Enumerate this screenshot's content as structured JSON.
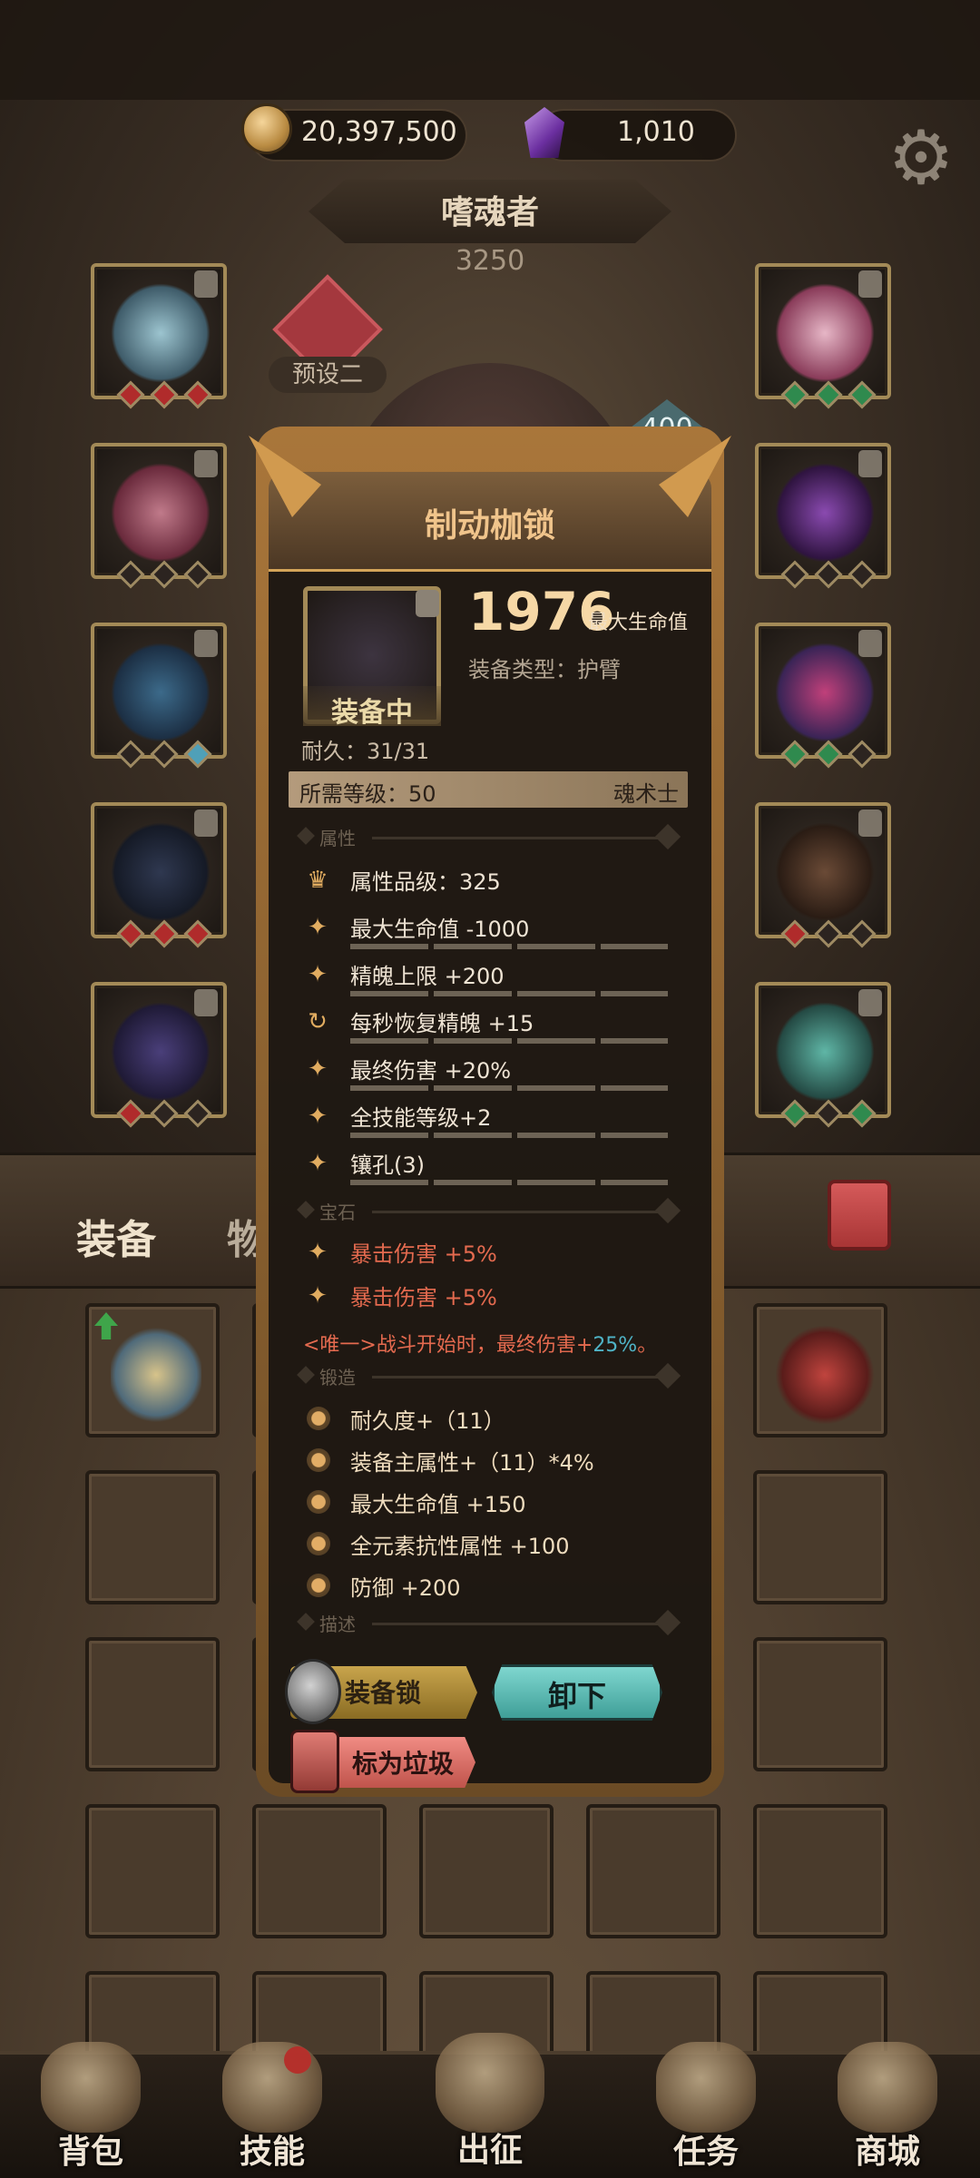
{
  "currencies": {
    "gold": "20,397,500",
    "gems": "1,010"
  },
  "character": {
    "name": "嗜魂者",
    "power": "3250",
    "preset": "预设二",
    "level_badge": "400"
  },
  "tabs": {
    "equipment": "装备",
    "items": "物品"
  },
  "popup": {
    "title": "制动枷锁",
    "main_value": "1976",
    "main_value_label": "最大生命值",
    "equip_type": "装备类型：护臂",
    "equipped": "装备中",
    "durability": "耐久：31/31",
    "required_level": "所需等级：50",
    "required_class": "魂术士",
    "sections": {
      "attributes": "属性",
      "gems": "宝石",
      "forge": "锻造",
      "description": "描述"
    },
    "attributes": [
      {
        "icon": "quality-icon",
        "text": "属性品级：325"
      },
      {
        "icon": "star-icon",
        "text": "最大生命值 -1000"
      },
      {
        "icon": "star-icon",
        "text": "精魄上限 +200"
      },
      {
        "icon": "regen-icon",
        "text": "每秒恢复精魄 +15"
      },
      {
        "icon": "star-icon",
        "text": "最终伤害 +20%"
      },
      {
        "icon": "star-icon",
        "text": "全技能等级+2"
      },
      {
        "icon": "star-icon",
        "text": "镶孔(3)"
      }
    ],
    "gem_stats": [
      "暴击伤害 +5%",
      "暴击伤害 +5%"
    ],
    "unique_prefix": "<唯一>战斗开始时，最终伤害+",
    "unique_highlight": "25%",
    "unique_suffix": "。",
    "forge_stats": [
      "耐久度+（11）",
      "装备主属性+（11）*4%",
      "最大生命值 +150",
      "全元素抗性属性 +100",
      "防御 +200"
    ],
    "buttons": {
      "lock": "装备锁",
      "unequip": "卸下",
      "mark_trash": "标为垃圾"
    }
  },
  "nav": [
    {
      "label": "背包",
      "icon": "backpack-icon"
    },
    {
      "label": "技能",
      "icon": "skills-book-icon"
    },
    {
      "label": "出征",
      "icon": "sword-map-icon"
    },
    {
      "label": "任务",
      "icon": "scroll-icon"
    },
    {
      "label": "商城",
      "icon": "shop-icon"
    }
  ],
  "colors": {
    "accent_gold": "#f0c48b",
    "stat_red": "#e46a4f",
    "stat_cyan": "#4fb3c6",
    "unequip_teal": "#5fbcb5"
  }
}
